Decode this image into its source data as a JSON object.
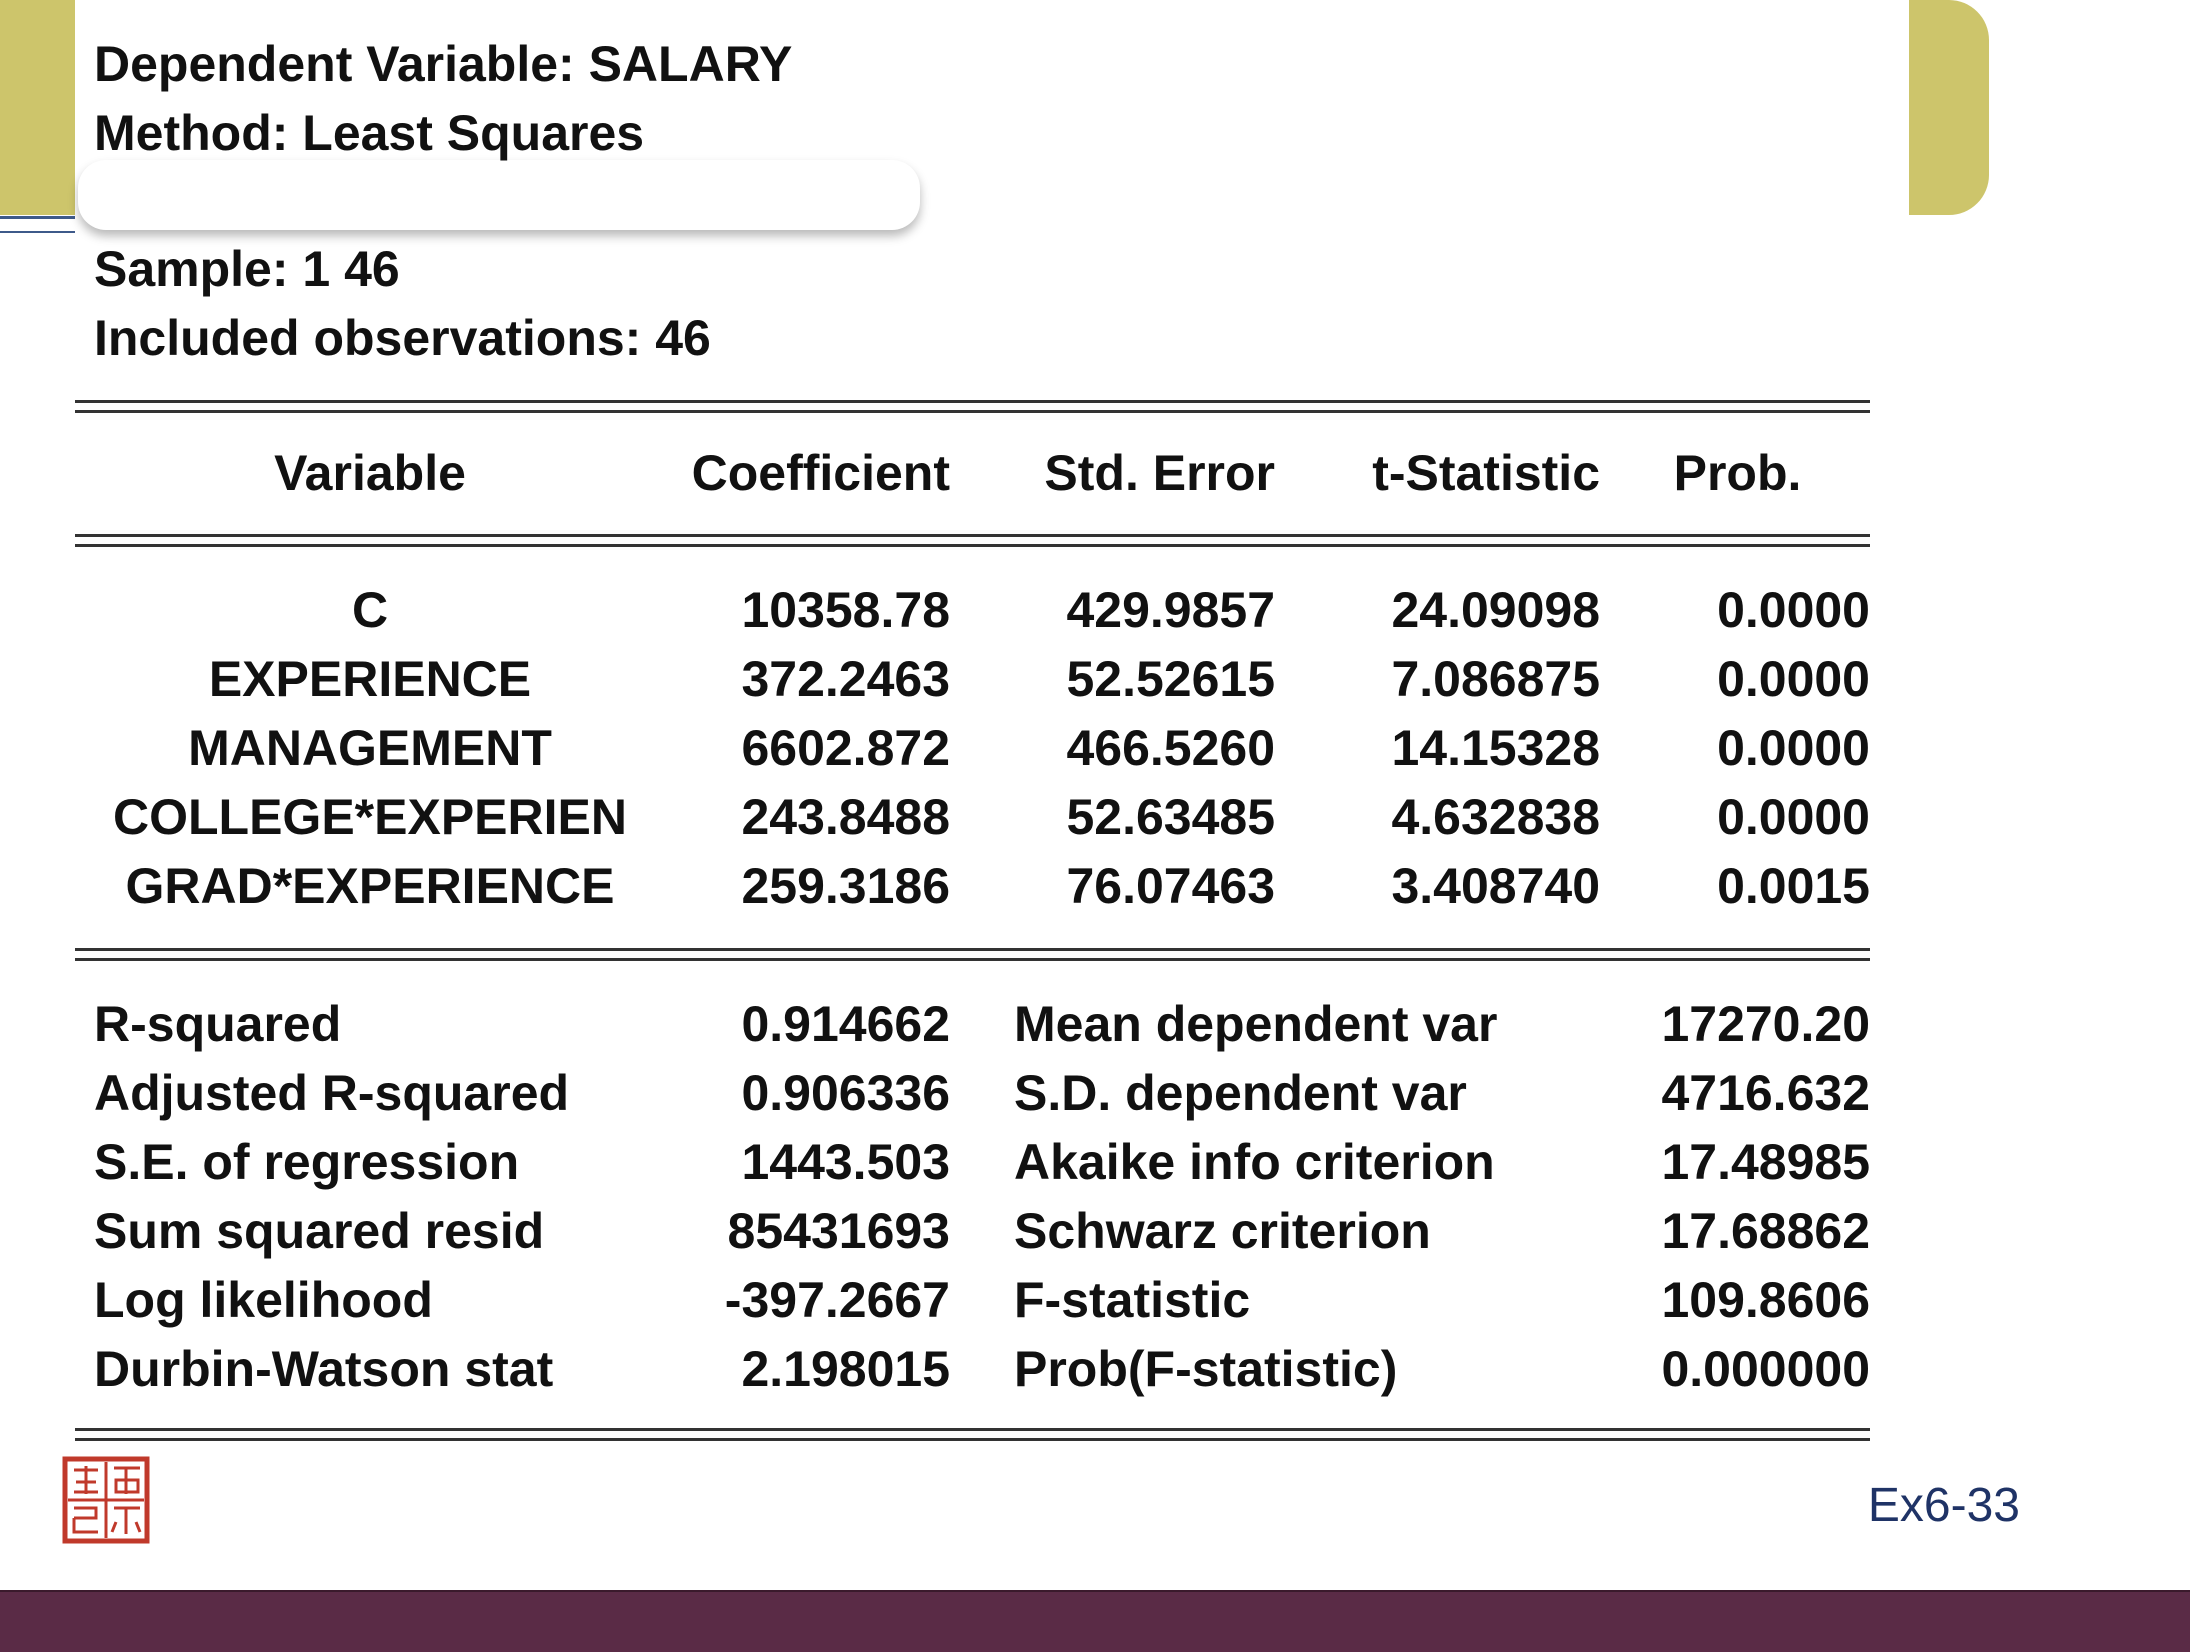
{
  "header": {
    "dependent": "Dependent Variable: SALARY",
    "method": "Method: Least Squares",
    "sample": "Sample: 1 46",
    "observations": "Included observations: 46"
  },
  "table": {
    "columns": [
      "Variable",
      "Coefficient",
      "Std. Error",
      "t-Statistic",
      "Prob."
    ],
    "rows": [
      [
        "C",
        "10358.78",
        "429.9857",
        "24.09098",
        "0.0000"
      ],
      [
        "EXPERIENCE",
        "372.2463",
        "52.52615",
        "7.086875",
        "0.0000"
      ],
      [
        "MANAGEMENT",
        "6602.872",
        "466.5260",
        "14.15328",
        "0.0000"
      ],
      [
        "COLLEGE*EXPERIEN",
        "243.8488",
        "52.63485",
        "4.632838",
        "0.0000"
      ],
      [
        "GRAD*EXPERIENCE",
        "259.3186",
        "76.07463",
        "3.408740",
        "0.0015"
      ]
    ]
  },
  "stats": [
    [
      "R-squared",
      "0.914662",
      "Mean dependent var",
      "17270.20"
    ],
    [
      "Adjusted R-squared",
      "0.906336",
      "S.D. dependent var",
      "4716.632"
    ],
    [
      "S.E. of regression",
      "1443.503",
      "Akaike info criterion",
      "17.48985"
    ],
    [
      "Sum squared resid",
      "85431693",
      "Schwarz criterion",
      "17.68862"
    ],
    [
      "Log likelihood",
      "-397.2667",
      "F-statistic",
      "109.8606"
    ],
    [
      "Durbin-Watson stat",
      "2.198015",
      "Prob(F-statistic)",
      "0.000000"
    ]
  ],
  "footer": {
    "label": "Ex6-33"
  },
  "colors": {
    "accent": "#cdc56b",
    "bottom_bar": "#5a2b46",
    "seal": "#c0392b",
    "footer_text": "#1f3366"
  },
  "icons": {
    "seal": "seal-stamp-icon"
  }
}
